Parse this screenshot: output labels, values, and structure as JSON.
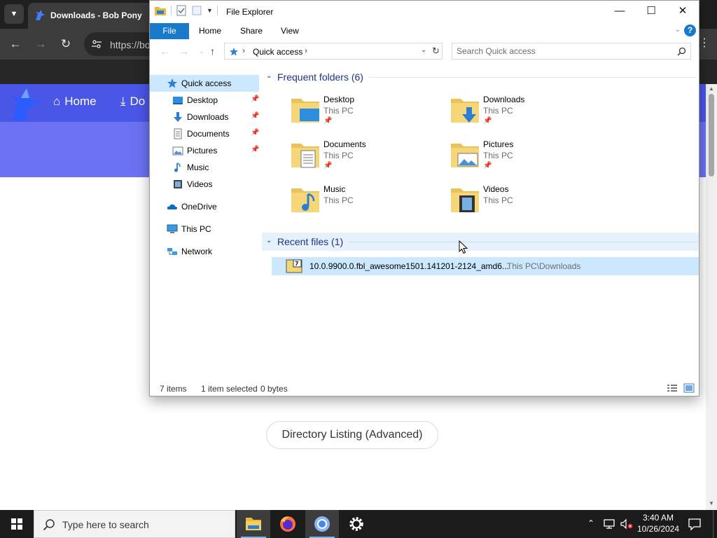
{
  "browser": {
    "tab_title": "Downloads - Bob Pony",
    "url": "https://bo",
    "nav_links": [
      {
        "label": "Home",
        "icon": "home-icon"
      },
      {
        "label": "Do",
        "icon": "download-icon"
      }
    ],
    "directory_button": "Directory Listing (Advanced)"
  },
  "explorer": {
    "title": "File Explorer",
    "ribbon_tabs": [
      "File",
      "Home",
      "Share",
      "View"
    ],
    "address": {
      "crumb": "Quick access"
    },
    "search": {
      "placeholder": "Search Quick access"
    },
    "nav_pane": {
      "quick_access": "Quick access",
      "pinned": [
        {
          "label": "Desktop",
          "icon": "desktop-icon",
          "pinned": true
        },
        {
          "label": "Downloads",
          "icon": "downloads-icon",
          "pinned": true
        },
        {
          "label": "Documents",
          "icon": "documents-icon",
          "pinned": true
        },
        {
          "label": "Pictures",
          "icon": "pictures-icon",
          "pinned": true
        },
        {
          "label": "Music",
          "icon": "music-icon",
          "pinned": false
        },
        {
          "label": "Videos",
          "icon": "videos-icon",
          "pinned": false
        }
      ],
      "onedrive": "OneDrive",
      "this_pc": "This PC",
      "network": "Network"
    },
    "frequent_folders": {
      "header": "Frequent folders (6)",
      "items": [
        {
          "name": "Desktop",
          "location": "This PC",
          "pinned": true
        },
        {
          "name": "Downloads",
          "location": "This PC",
          "pinned": true
        },
        {
          "name": "Documents",
          "location": "This PC",
          "pinned": true
        },
        {
          "name": "Pictures",
          "location": "This PC",
          "pinned": true
        },
        {
          "name": "Music",
          "location": "This PC",
          "pinned": false
        },
        {
          "name": "Videos",
          "location": "This PC",
          "pinned": false
        }
      ]
    },
    "recent_files": {
      "header": "Recent files (1)",
      "items": [
        {
          "name": "10.0.9900.0.fbl_awesome1501.141201-2124_amd6...",
          "path": "This PC\\Downloads"
        }
      ]
    },
    "status": {
      "items": "7 items",
      "selected": "1 item selected",
      "size": "0 bytes"
    }
  },
  "taskbar": {
    "search_placeholder": "Type here to search",
    "apps": [
      "file-explorer",
      "firefox",
      "chrome",
      "settings"
    ],
    "time": "3:40 AM",
    "date": "10/26/2024"
  },
  "colors": {
    "accent_blue": "#1979ca",
    "selection": "#cce8ff",
    "group_header": "#1e3287",
    "site_nav": "#4a56e6",
    "site_banner": "#6b71f3",
    "taskbar": "#1b1b1b"
  }
}
